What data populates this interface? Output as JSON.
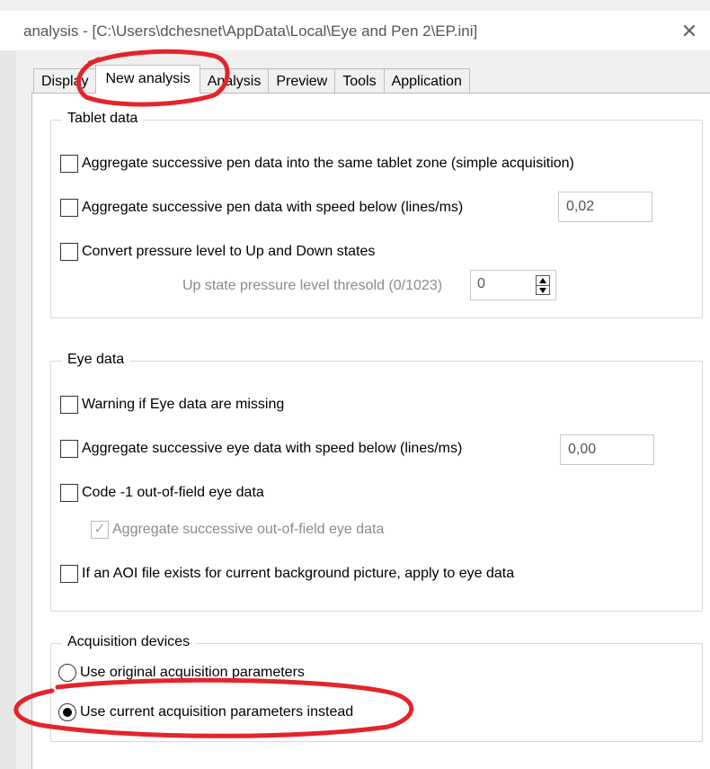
{
  "window": {
    "title": "analysis - [C:\\Users\\dchesnet\\AppData\\Local\\Eye and Pen 2\\EP.ini]",
    "close_glyph": "✕"
  },
  "tabs": [
    {
      "label": "Display"
    },
    {
      "label": "New analysis",
      "active": true
    },
    {
      "label": "Analysis"
    },
    {
      "label": "Preview"
    },
    {
      "label": "Tools"
    },
    {
      "label": "Application"
    }
  ],
  "tablet": {
    "legend": "Tablet data",
    "aggregate_zone": {
      "label": "Aggregate successive pen data into the same tablet zone (simple acquisition)",
      "checked": false
    },
    "aggregate_speed": {
      "label": "Aggregate successive pen data with speed below (lines/ms)",
      "checked": false,
      "value": "0,02"
    },
    "convert_pressure": {
      "label": "Convert pressure level  to Up and Down states",
      "checked": false
    },
    "threshold": {
      "label": "Up state pressure level thresold (0/1023)",
      "value": "0"
    }
  },
  "eye": {
    "legend": "Eye data",
    "warning_missing": {
      "label": "Warning if Eye data are missing",
      "checked": false
    },
    "aggregate_speed": {
      "label": "Aggregate successive eye data with speed below (lines/ms)",
      "checked": false,
      "value": "0,00"
    },
    "code_out_of_field": {
      "label": "Code -1 out-of-field eye data",
      "checked": false
    },
    "aggregate_out_of_field": {
      "label": "Aggregate successive out-of-field eye data",
      "checked": true,
      "disabled": true
    },
    "aoi_apply": {
      "label": "If an AOI file exists for current background picture, apply to eye data",
      "checked": false
    }
  },
  "acquisition": {
    "legend": "Acquisition devices",
    "use_original": {
      "label": "Use original acquisition parameters",
      "selected": false
    },
    "use_current": {
      "label": "Use current acquisition parameters instead",
      "selected": true
    }
  },
  "colors": {
    "annotation": "#e3242b",
    "panel": "#ffffff",
    "chrome": "#f0f0f0"
  },
  "icons": {
    "close": "close-icon",
    "check": "check-icon",
    "spin_up": "spin-up-icon",
    "spin_down": "spin-down-icon"
  }
}
